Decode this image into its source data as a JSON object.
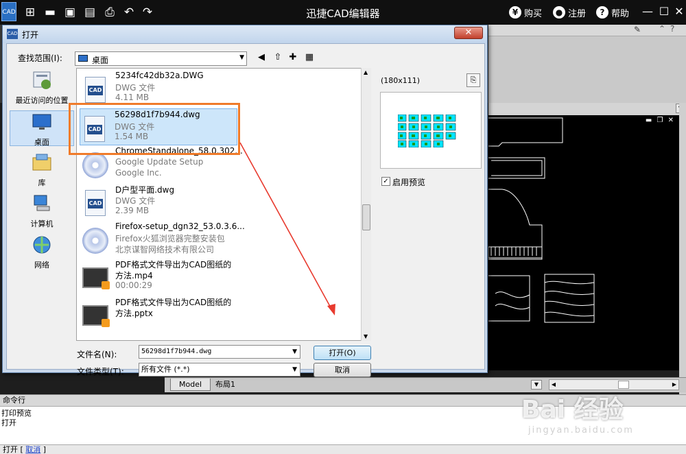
{
  "app": {
    "logo": "CAD",
    "title": "迅捷CAD编辑器",
    "buy": "购买",
    "register": "注册",
    "help": "帮助"
  },
  "dialog": {
    "title": "打开",
    "look_in_label": "查找范围(I):",
    "look_in_value": "桌面",
    "places": [
      {
        "label": "最近访问的位置"
      },
      {
        "label": "桌面"
      },
      {
        "label": "库"
      },
      {
        "label": "计算机"
      },
      {
        "label": "网络"
      }
    ],
    "files": [
      {
        "name": "5234fc42db32a.DWG",
        "type": "DWG 文件",
        "size": "4.11 MB"
      },
      {
        "name": "56298d1f7b944.dwg",
        "type": "DWG 文件",
        "size": "1.54 MB"
      },
      {
        "name": "ChromeStandalone_58.0.302...",
        "type": "Google Update Setup",
        "size": "Google Inc."
      },
      {
        "name": "D户型平面.dwg",
        "type": "DWG 文件",
        "size": "2.39 MB"
      },
      {
        "name": "Firefox-setup_dgn32_53.0.3.6...",
        "type": "Firefox火狐浏览器完整安装包",
        "size": "北京谋智网络技术有限公司"
      },
      {
        "name": "PDF格式文件导出为CAD图纸的",
        "type": "方法.mp4",
        "size": "00:00:29"
      },
      {
        "name": "PDF格式文件导出为CAD图纸的",
        "type": "方法.pptx",
        "size": ""
      }
    ],
    "preview_dims": "(180x111)",
    "enable_preview_label": "启用预览",
    "filename_label": "文件名(N):",
    "filename_value": "56298d1f7b944.dwg",
    "filetype_label": "文件类型(T):",
    "filetype_value": "所有文件 (*.*)",
    "open_button": "打开(O)",
    "cancel_button": "取消"
  },
  "layout_tabs": {
    "model": "Model",
    "layout1": "布局1"
  },
  "command": {
    "header": "命令行",
    "history": [
      "打印预览",
      "打开"
    ],
    "prompt": "打开 [",
    "cancel_option": "取消",
    "prompt_end": "]"
  },
  "watermark": {
    "brand": "Bai 经验",
    "url": "jingyan.baidu.com"
  },
  "colors": {
    "highlight": "#f07b2a",
    "arrow": "#e83a2e"
  }
}
